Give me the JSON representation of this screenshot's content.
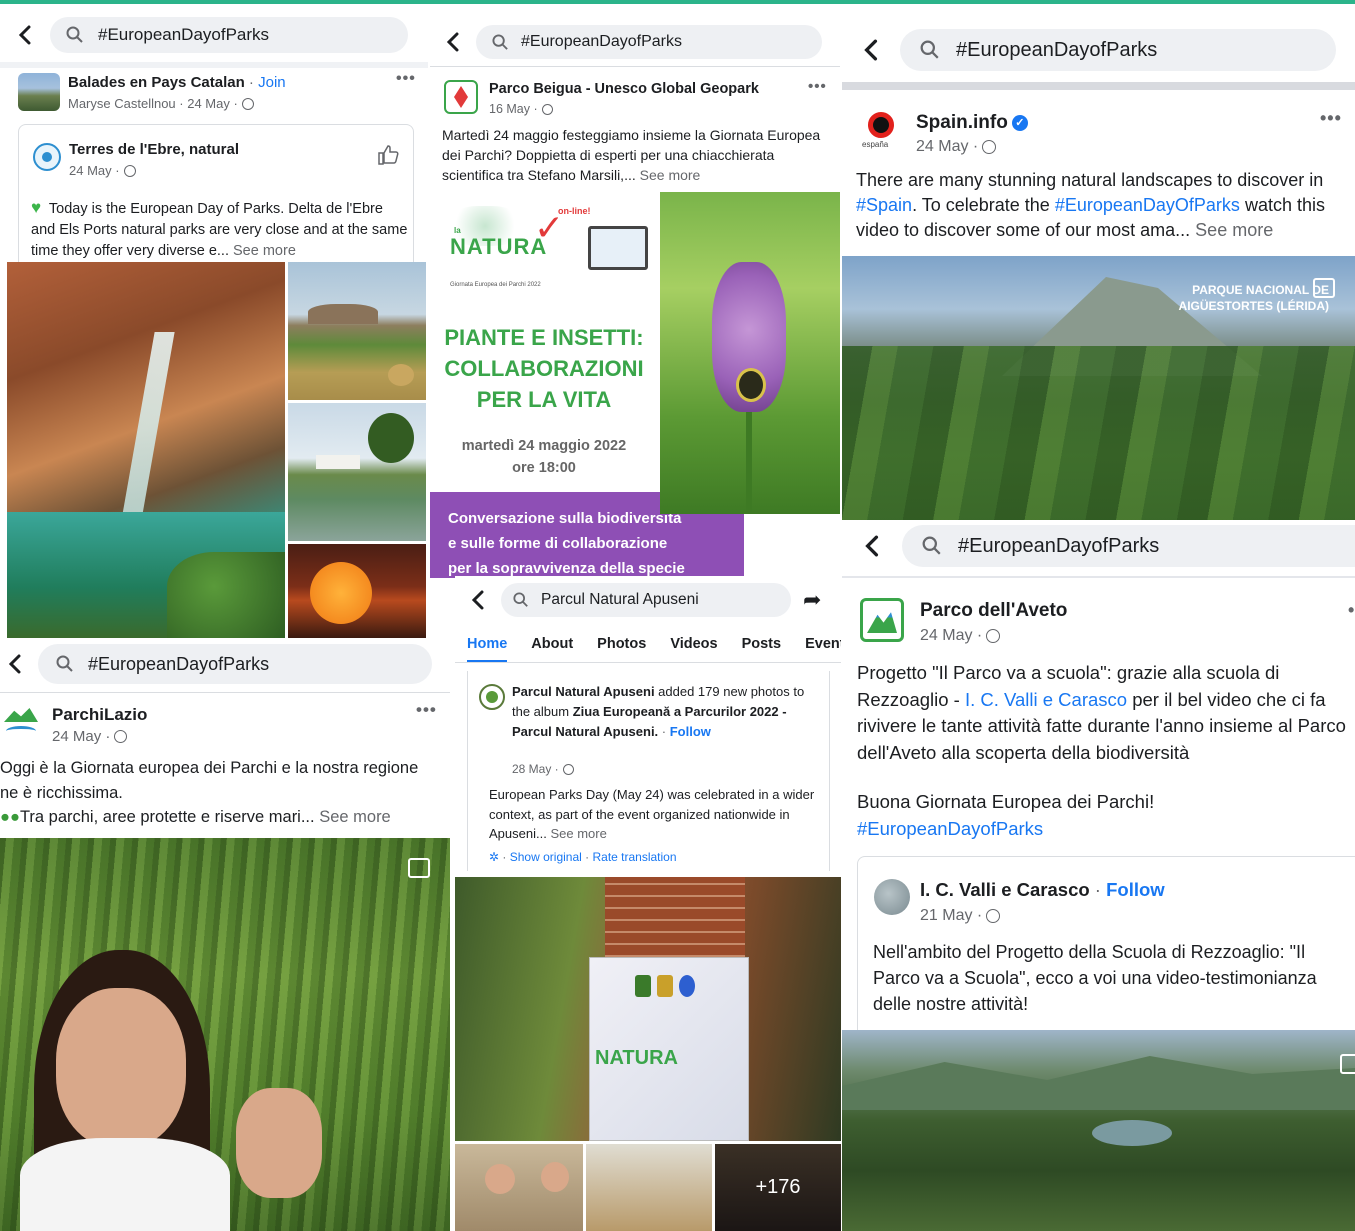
{
  "colors": {
    "accent_strip": "#2bb48a",
    "link": "#1877f2",
    "muted": "#65676b",
    "search_bg": "#eef0f3"
  },
  "panel1": {
    "search_text": "#EuropeanDayofParks",
    "post": {
      "name": "Balades en Pays Catalan",
      "join": "Join",
      "sep": " · ",
      "meta": "Maryse Castellnou · 24 May ·",
      "shared": {
        "name": "Terres de l'Ebre, natural",
        "meta": "24 May ·",
        "text": "Today is the European Day of Parks. Delta de l'Ebre and Els Ports natural parks are very close and at the same time they offer very diverse e...",
        "see_more": "See more",
        "icon": "green-heart-icon"
      }
    }
  },
  "panel2": {
    "search_text": "#EuropeanDayofParks",
    "post": {
      "name": "Parco Beigua - Unesco Global Geopark",
      "meta": "16 May ·",
      "text": "Martedì 24 maggio festeggiamo insieme la Giornata Europea dei Parchi? Doppietta di esperti per una chiacchierata scientifica tra Stefano Marsili,...",
      "see_more": "See more",
      "poster": {
        "brand": "NATURA",
        "brand_top": "la",
        "brand_sub": "Giornata Europea dei Parchi 2022",
        "badge": "on-line!",
        "headline": [
          "PIANTE E INSETTI:",
          "COLLABORAZIONI",
          "PER LA VITA"
        ],
        "date": "martedì 24 maggio 2022",
        "time": "ore 18:00",
        "banner": [
          "Conversazione sulla biodiversità",
          "e sulle forme di collaborazione",
          "per la sopravvivenza della specie"
        ]
      }
    }
  },
  "panel3": {
    "search_text": "#EuropeanDayofParks",
    "post": {
      "name": "Spain.info",
      "meta": "24 May ·",
      "text_1": "There are many stunning natural landscapes to discover in ",
      "tag_1": "#Spain",
      "text_2": ". To celebrate the ",
      "tag_2": "#EuropeanDayOfParks",
      "text_3": " watch this video to discover some of our most ama...",
      "see_more": "See more",
      "logo_text": "españa",
      "video_caption": [
        "PARQUE NACIONAL DE",
        "AIGÜESTORTES (LÉRIDA)"
      ]
    }
  },
  "panel4": {
    "search_text": "#EuropeanDayofParks",
    "post": {
      "name": "ParchiLazio",
      "meta": "24 May ·",
      "text_line1": "Oggi è la Giornata europea dei Parchi e la nostra regione",
      "text_line2": "ne è ricchissima.",
      "text_line3": "Tra parchi, aree protette e riserve mari...",
      "see_more": "See more"
    }
  },
  "panel5": {
    "search_text": "Parcul Natural Apuseni",
    "tabs": [
      "Home",
      "About",
      "Photos",
      "Videos",
      "Posts",
      "Events"
    ],
    "post": {
      "name": "Parcul Natural Apuseni",
      "action": " added 179 new photos to the album ",
      "album": "Ziua Europeană a Parcurilor 2022 - Parcul Natural Apuseni.",
      "sep": " · ",
      "follow": "Follow",
      "meta": "28 May ·",
      "text": "European Parks Day (May 24) was celebrated in a wider context, as part of the event organized nationwide in Apuseni...",
      "see_more": "See more",
      "show_original": "Show original",
      "rate_translation": "Rate translation",
      "dot": "·",
      "photo_count": "+176",
      "banner_brand": "NATURA"
    }
  },
  "panel6": {
    "search_text": "#EuropeanDayofParks",
    "post": {
      "name": "Parco dell'Aveto",
      "meta": "24 May ·",
      "text_a": "Progetto \"Il Parco va a scuola\": grazie alla scuola di Rezzoaglio - ",
      "tag": "I. C. Valli e Carasco",
      "text_b": " per il bel video che ci fa rivivere le tante attività fatte durante l'anno insieme al Parco dell'Aveto alla scoperta della biodiversità",
      "text_c": "Buona Giornata Europea dei Parchi!",
      "hashtag": "#EuropeanDayofParks",
      "shared": {
        "name": "I. C. Valli e Carasco",
        "follow": "Follow",
        "sep": " · ",
        "meta": "21 May ·",
        "text": "Nell'ambito del Progetto della Scuola di Rezzoaglio: \"Il Parco va a Scuola\", ecco a voi una video-testimonianza delle nostre attività!"
      }
    }
  }
}
